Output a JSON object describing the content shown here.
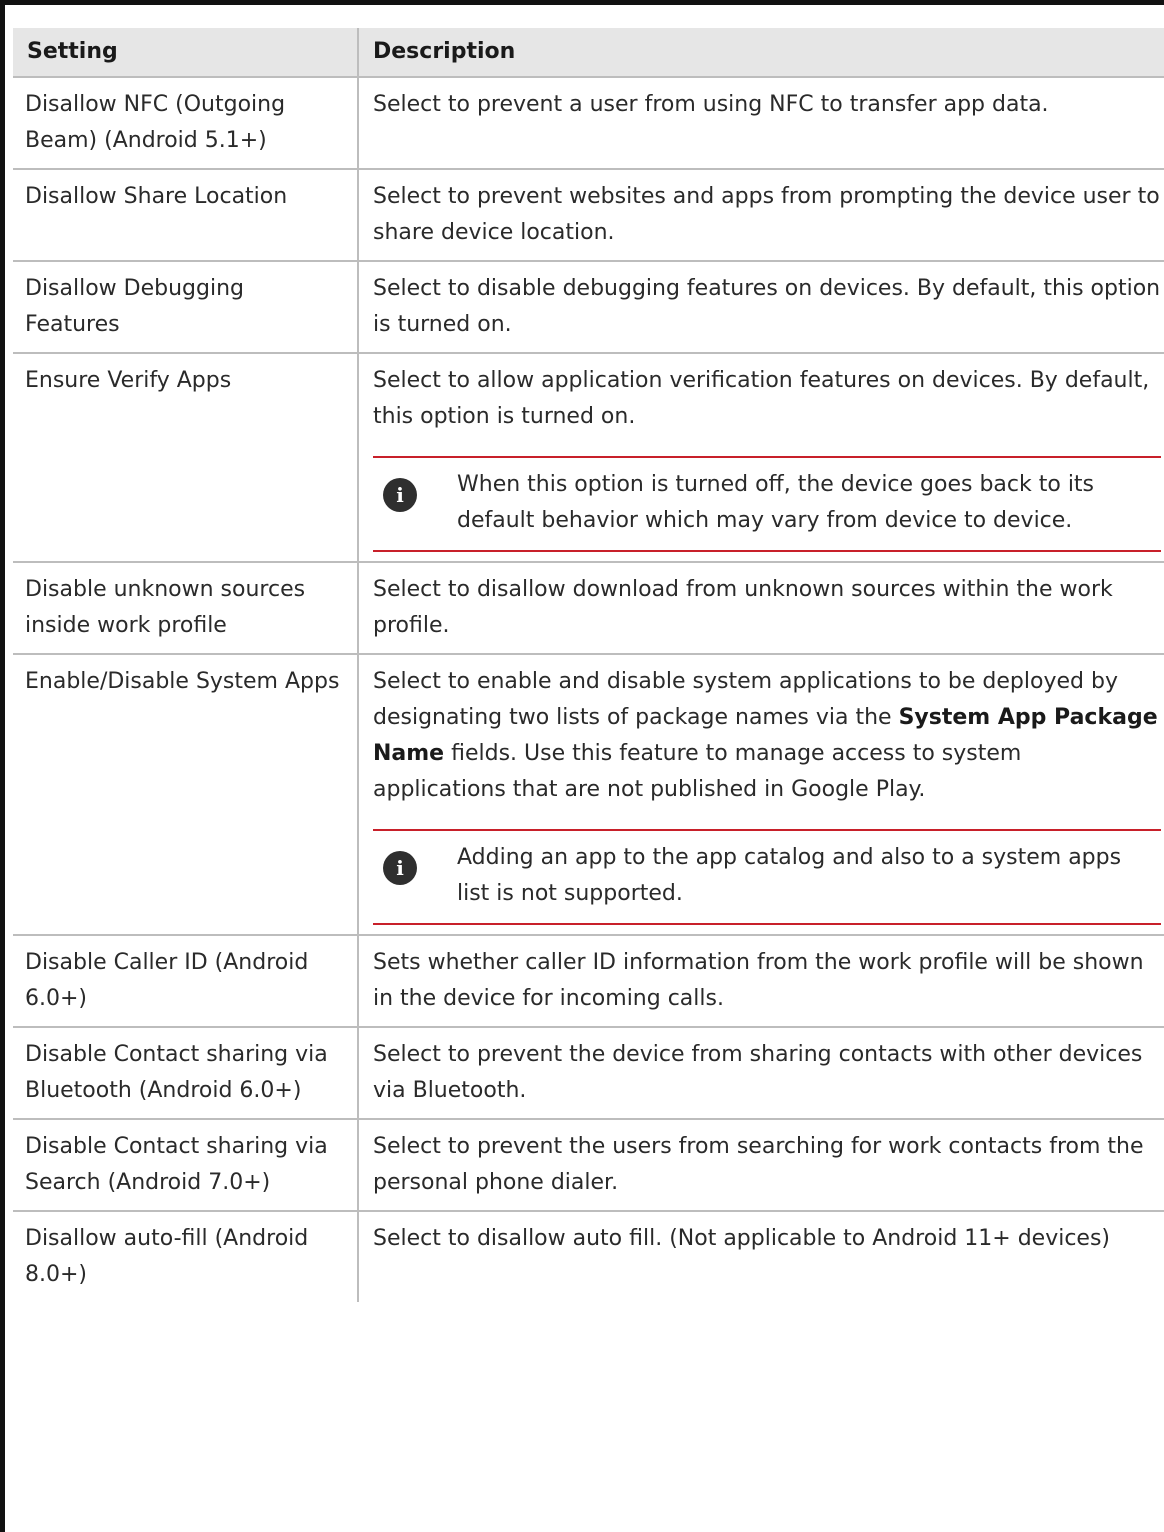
{
  "table": {
    "headers": {
      "setting": "Setting",
      "description": "Description"
    },
    "rows": [
      {
        "setting": "Disallow NFC (Outgoing Beam) (Android 5.1+)",
        "description": "Select to prevent a user from using NFC to transfer app data."
      },
      {
        "setting": "Disallow Share Location",
        "description": "Select to prevent websites and apps from prompting the device user to share device location."
      },
      {
        "setting": "Disallow Debugging Features",
        "description": "Select to disable debugging features on devices. By default, this option is turned on."
      },
      {
        "setting": "Ensure Verify Apps",
        "description": "Select to allow application verification features on devices. By default, this option is turned on.",
        "note": "When this option is turned off, the device goes back to its default behavior which may vary from device to device."
      },
      {
        "setting": "Disable unknown sources inside work profile",
        "description": "Select to disallow download from unknown sources within the work profile."
      },
      {
        "setting": "Enable/Disable System Apps",
        "description_parts": {
          "before": "Select to enable and disable system applications to be deployed by designating two lists of package names via the ",
          "bold": "System App Package Name",
          "after": " fields. Use this feature to manage access to system applications that are not published in Google Play."
        },
        "note": "Adding an app to the app catalog and also to a system apps list is not supported."
      },
      {
        "setting": "Disable Caller ID (Android 6.0+)",
        "description": "Sets whether caller ID information from the work profile will be shown in the device for incoming calls."
      },
      {
        "setting": "Disable Contact sharing via Bluetooth (Android 6.0+)",
        "description": "Select to prevent the device from sharing contacts with other devices via Bluetooth."
      },
      {
        "setting": "Disable Contact sharing via Search (Android 7.0+)",
        "description": "Select to prevent the users from searching for work contacts from the personal phone dialer."
      },
      {
        "setting": "Disallow auto-fill (Android 8.0+)",
        "description": "Select to disallow auto fill. (Not applicable to Android 11+ devices)"
      }
    ]
  },
  "icons": {
    "note_icon": "info-icon",
    "note_icon_glyph": "i"
  },
  "colors": {
    "header_bg": "#e6e6e6",
    "grid": "#bdbdbd",
    "note_rule": "#c8202a",
    "icon_bg": "#2f2f2f"
  }
}
